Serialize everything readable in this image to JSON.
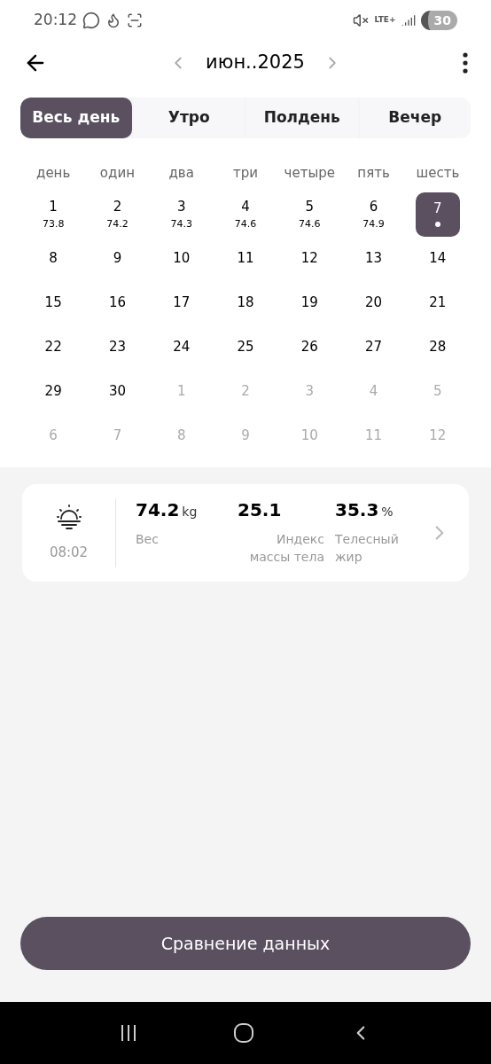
{
  "status_bar": {
    "time": "20:12",
    "network": "LTE+",
    "battery": "30"
  },
  "header": {
    "month": "июн..2025"
  },
  "tabs": [
    {
      "label": "Весь день",
      "selected": true
    },
    {
      "label": "Утро",
      "selected": false
    },
    {
      "label": "Полдень",
      "selected": false
    },
    {
      "label": "Вечер",
      "selected": false
    }
  ],
  "weekdays": [
    "день",
    "один",
    "два",
    "три",
    "четыре",
    "пять",
    "шесть"
  ],
  "days": [
    {
      "day": "1",
      "weight": "73.8",
      "in_month": true,
      "selected": false
    },
    {
      "day": "2",
      "weight": "74.2",
      "in_month": true,
      "selected": false
    },
    {
      "day": "3",
      "weight": "74.3",
      "in_month": true,
      "selected": false
    },
    {
      "day": "4",
      "weight": "74.6",
      "in_month": true,
      "selected": false
    },
    {
      "day": "5",
      "weight": "74.6",
      "in_month": true,
      "selected": false
    },
    {
      "day": "6",
      "weight": "74.9",
      "in_month": true,
      "selected": false
    },
    {
      "day": "7",
      "in_month": true,
      "selected": true
    },
    {
      "day": "8",
      "in_month": true,
      "selected": false
    },
    {
      "day": "9",
      "in_month": true,
      "selected": false
    },
    {
      "day": "10",
      "in_month": true,
      "selected": false
    },
    {
      "day": "11",
      "in_month": true,
      "selected": false
    },
    {
      "day": "12",
      "in_month": true,
      "selected": false
    },
    {
      "day": "13",
      "in_month": true,
      "selected": false
    },
    {
      "day": "14",
      "in_month": true,
      "selected": false
    },
    {
      "day": "15",
      "in_month": true,
      "selected": false
    },
    {
      "day": "16",
      "in_month": true,
      "selected": false
    },
    {
      "day": "17",
      "in_month": true,
      "selected": false
    },
    {
      "day": "18",
      "in_month": true,
      "selected": false
    },
    {
      "day": "19",
      "in_month": true,
      "selected": false
    },
    {
      "day": "20",
      "in_month": true,
      "selected": false
    },
    {
      "day": "21",
      "in_month": true,
      "selected": false
    },
    {
      "day": "22",
      "in_month": true,
      "selected": false
    },
    {
      "day": "23",
      "in_month": true,
      "selected": false
    },
    {
      "day": "24",
      "in_month": true,
      "selected": false
    },
    {
      "day": "25",
      "in_month": true,
      "selected": false
    },
    {
      "day": "26",
      "in_month": true,
      "selected": false
    },
    {
      "day": "27",
      "in_month": true,
      "selected": false
    },
    {
      "day": "28",
      "in_month": true,
      "selected": false
    },
    {
      "day": "29",
      "in_month": true,
      "selected": false
    },
    {
      "day": "30",
      "in_month": true,
      "selected": false
    },
    {
      "day": "1",
      "in_month": false,
      "selected": false
    },
    {
      "day": "2",
      "in_month": false,
      "selected": false
    },
    {
      "day": "3",
      "in_month": false,
      "selected": false
    },
    {
      "day": "4",
      "in_month": false,
      "selected": false
    },
    {
      "day": "5",
      "in_month": false,
      "selected": false
    },
    {
      "day": "6",
      "in_month": false,
      "selected": false
    },
    {
      "day": "7",
      "in_month": false,
      "selected": false
    },
    {
      "day": "8",
      "in_month": false,
      "selected": false
    },
    {
      "day": "9",
      "in_month": false,
      "selected": false
    },
    {
      "day": "10",
      "in_month": false,
      "selected": false
    },
    {
      "day": "11",
      "in_month": false,
      "selected": false
    },
    {
      "day": "12",
      "in_month": false,
      "selected": false
    }
  ],
  "record": {
    "time": "08:02",
    "metrics": [
      {
        "value": "74.2",
        "unit": "kg",
        "label": "Вес"
      },
      {
        "value": "25.1",
        "label": "Индекс массы тела"
      },
      {
        "value": "35.3",
        "unit": "%",
        "label": "Телесный жир"
      }
    ]
  },
  "compare_button": "Сравнение данных"
}
